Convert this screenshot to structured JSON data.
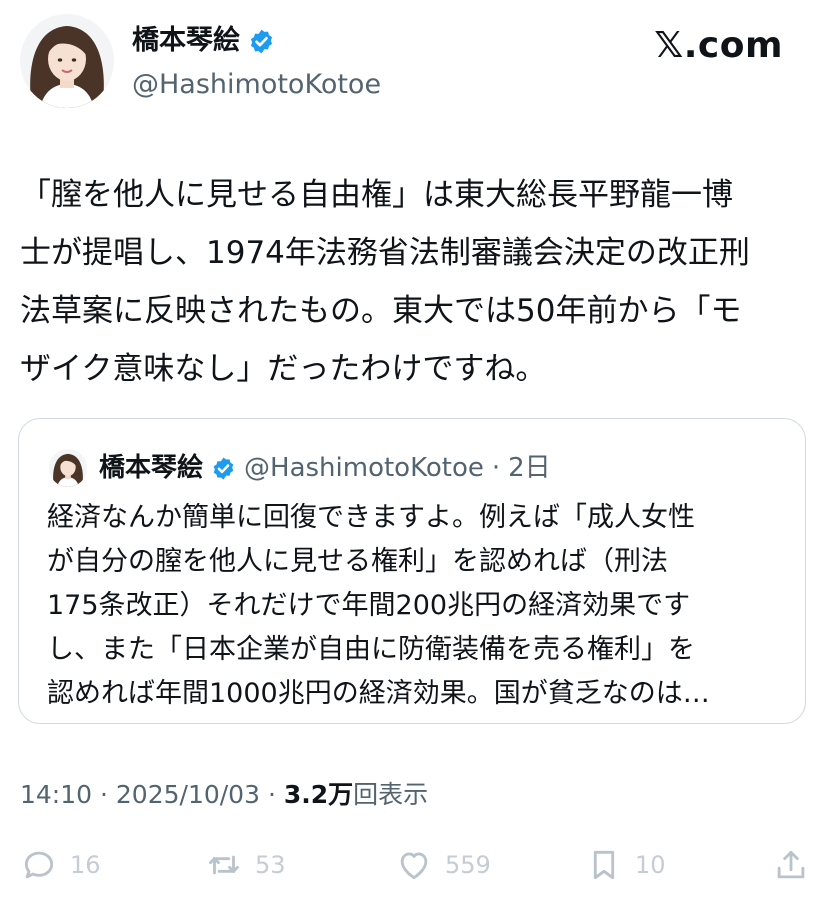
{
  "author": {
    "name": "橋本琴絵",
    "handle": "@HashimotoKotoe"
  },
  "brand": "𝕏.com",
  "tweet": {
    "text": "「膣を他人に見せる自由権」は東大総長平野龍一博\n士が提唱し、1974年法務省法制審議会決定の改正刑\n法草案に反映されたもの。東大では50年前から「モ\nザイク意味なし」だったわけですね。"
  },
  "quote": {
    "name": "橋本琴絵",
    "handle": "@HashimotoKotoe",
    "dot": "·",
    "time": "2日",
    "text": "経済なんか簡単に回復できますよ。例えば「成人女性\nが自分の膣を他人に見せる権利」を認めれば（刑法\n175条改正）それだけで年間200兆円の経済効果です\nし、また「日本企業が自由に防衛装備を売る権利」を\n認めれば年間1000兆円の経済効果。国が貧乏なのは…"
  },
  "meta": {
    "time": "14:10",
    "separator": "·",
    "date": "2025/10/03",
    "views_count": "3.2万",
    "views_label": "回表示"
  },
  "actions": {
    "replies": "16",
    "reposts": "53",
    "likes": "559",
    "bookmarks": "10"
  },
  "colors": {
    "verified": "#1d9bf0",
    "secondary_text": "#536471",
    "border": "#cfd9de",
    "action_icon": "#b9c3ca"
  }
}
